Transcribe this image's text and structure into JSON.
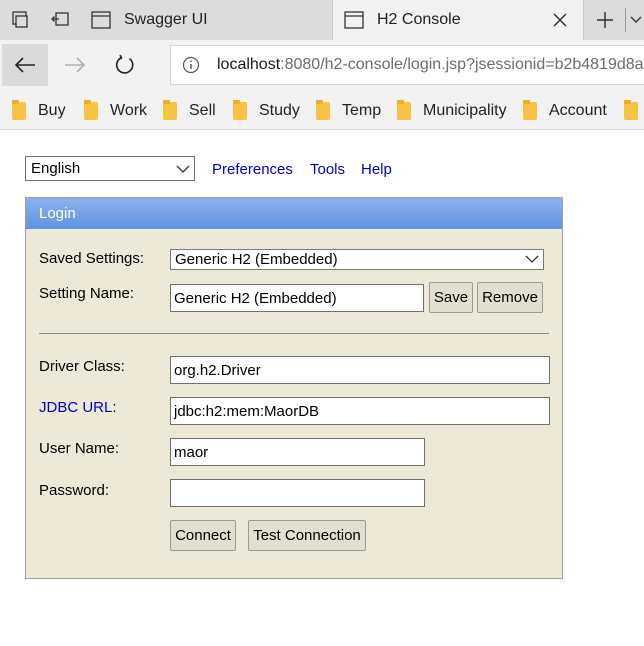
{
  "browser": {
    "tabs": [
      {
        "title": "Swagger UI",
        "active": false
      },
      {
        "title": "H2 Console",
        "active": true
      }
    ],
    "address": {
      "host": "localhost",
      "rest": ":8080/h2-console/login.jsp?jsessionid=b2b4819d8a"
    },
    "favorites": [
      {
        "label": "Buy"
      },
      {
        "label": "Work"
      },
      {
        "label": "Sell"
      },
      {
        "label": "Study"
      },
      {
        "label": "Temp"
      },
      {
        "label": "Municipality"
      },
      {
        "label": "Account"
      }
    ],
    "colors": {
      "tabstrip": "#dcdcdc",
      "active_tab": "#f2f2f2",
      "folder": "#f6c342"
    }
  },
  "page": {
    "language": "English",
    "links": {
      "preferences": "Preferences",
      "tools": "Tools",
      "help": "Help"
    },
    "login": {
      "header": "Login",
      "saved_settings_label": "Saved Settings:",
      "saved_settings_value": "Generic H2 (Embedded)",
      "setting_name_label": "Setting Name:",
      "setting_name_value": "Generic H2 (Embedded)",
      "save_button": "Save",
      "remove_button": "Remove",
      "driver_class_label": "Driver Class:",
      "driver_class_value": "org.h2.Driver",
      "jdbc_url_label": "JDBC URL",
      "jdbc_url_colon": ":",
      "jdbc_url_value": "jdbc:h2:mem:MaorDB",
      "user_name_label": "User Name:",
      "user_name_value": "maor",
      "password_label": "Password:",
      "password_value": "",
      "connect_button": "Connect",
      "test_connection_button": "Test Connection"
    },
    "colors": {
      "panel": "#ece9d8",
      "header": "#6f9fe6",
      "link": "#0000c8"
    }
  }
}
